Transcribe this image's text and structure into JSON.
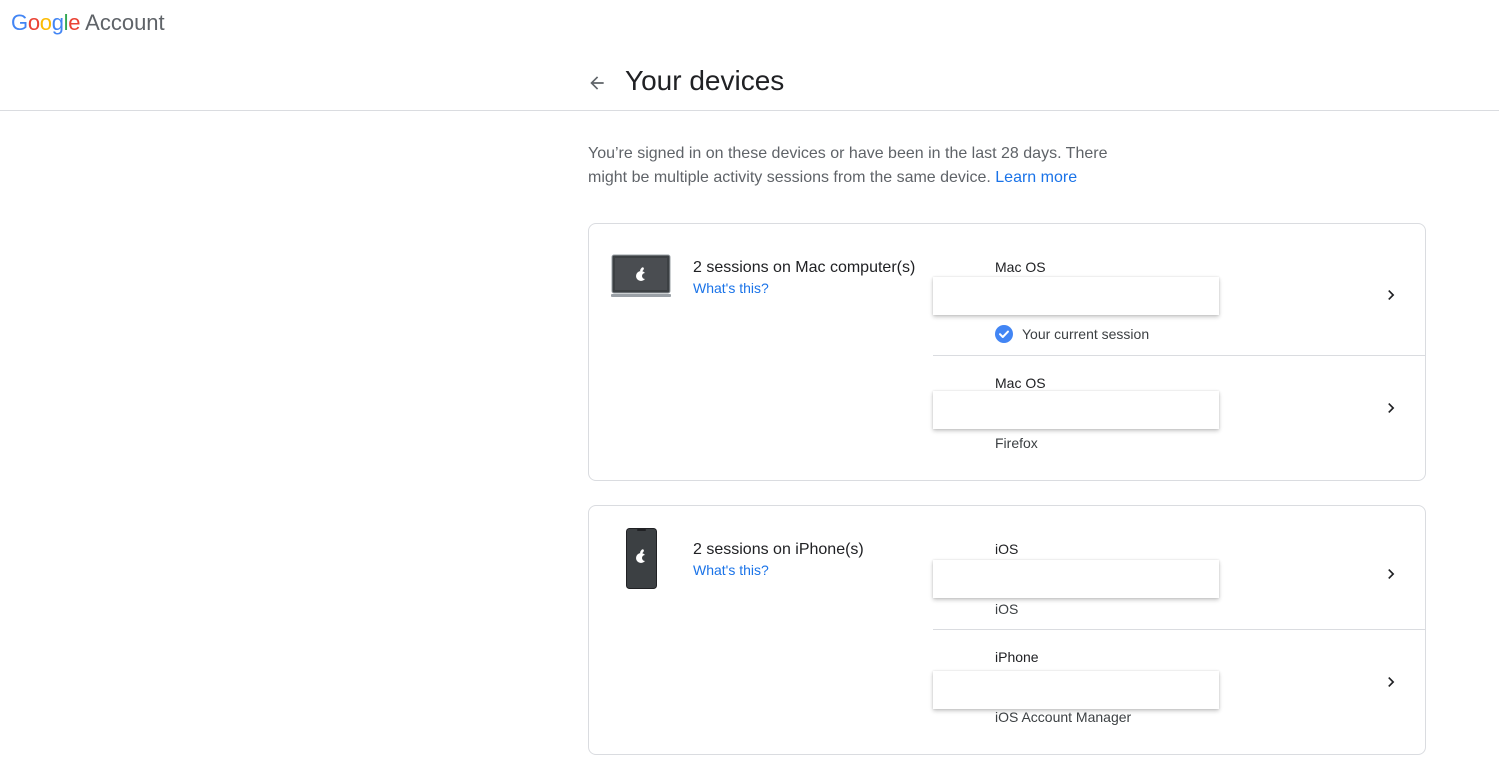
{
  "app": {
    "logo_word": "Google",
    "logo_letters": [
      {
        "ch": "G",
        "color": "#4285F4"
      },
      {
        "ch": "o",
        "color": "#EA4335"
      },
      {
        "ch": "o",
        "color": "#FBBC05"
      },
      {
        "ch": "g",
        "color": "#4285F4"
      },
      {
        "ch": "l",
        "color": "#34A853"
      },
      {
        "ch": "e",
        "color": "#EA4335"
      }
    ],
    "logo_suffix": "Account"
  },
  "header": {
    "back_icon": "arrow-back-icon",
    "title": "Your devices"
  },
  "intro": {
    "text": "You’re signed in on these devices or have been in the last 28 days. There might be multiple activity sessions from the same device.",
    "link": "Learn more"
  },
  "device_groups": [
    {
      "icon": "laptop-icon",
      "title": "2 sessions on Mac computer(s)",
      "help_link": "What's this?",
      "sessions": [
        {
          "name": "Mac OS",
          "sub": "Your current session",
          "current": true
        },
        {
          "name": "Mac OS",
          "sub": "Firefox",
          "current": false
        }
      ]
    },
    {
      "icon": "phone-icon",
      "title": "2 sessions on iPhone(s)",
      "help_link": "What's this?",
      "sessions": [
        {
          "name": "iOS",
          "sub": "iOS",
          "current": false
        },
        {
          "name": "iPhone",
          "sub": "iOS Account Manager",
          "current": false
        }
      ]
    }
  ],
  "colors": {
    "accent": "#1a73e8",
    "divider": "#dadce0",
    "check": "#4285F4"
  }
}
